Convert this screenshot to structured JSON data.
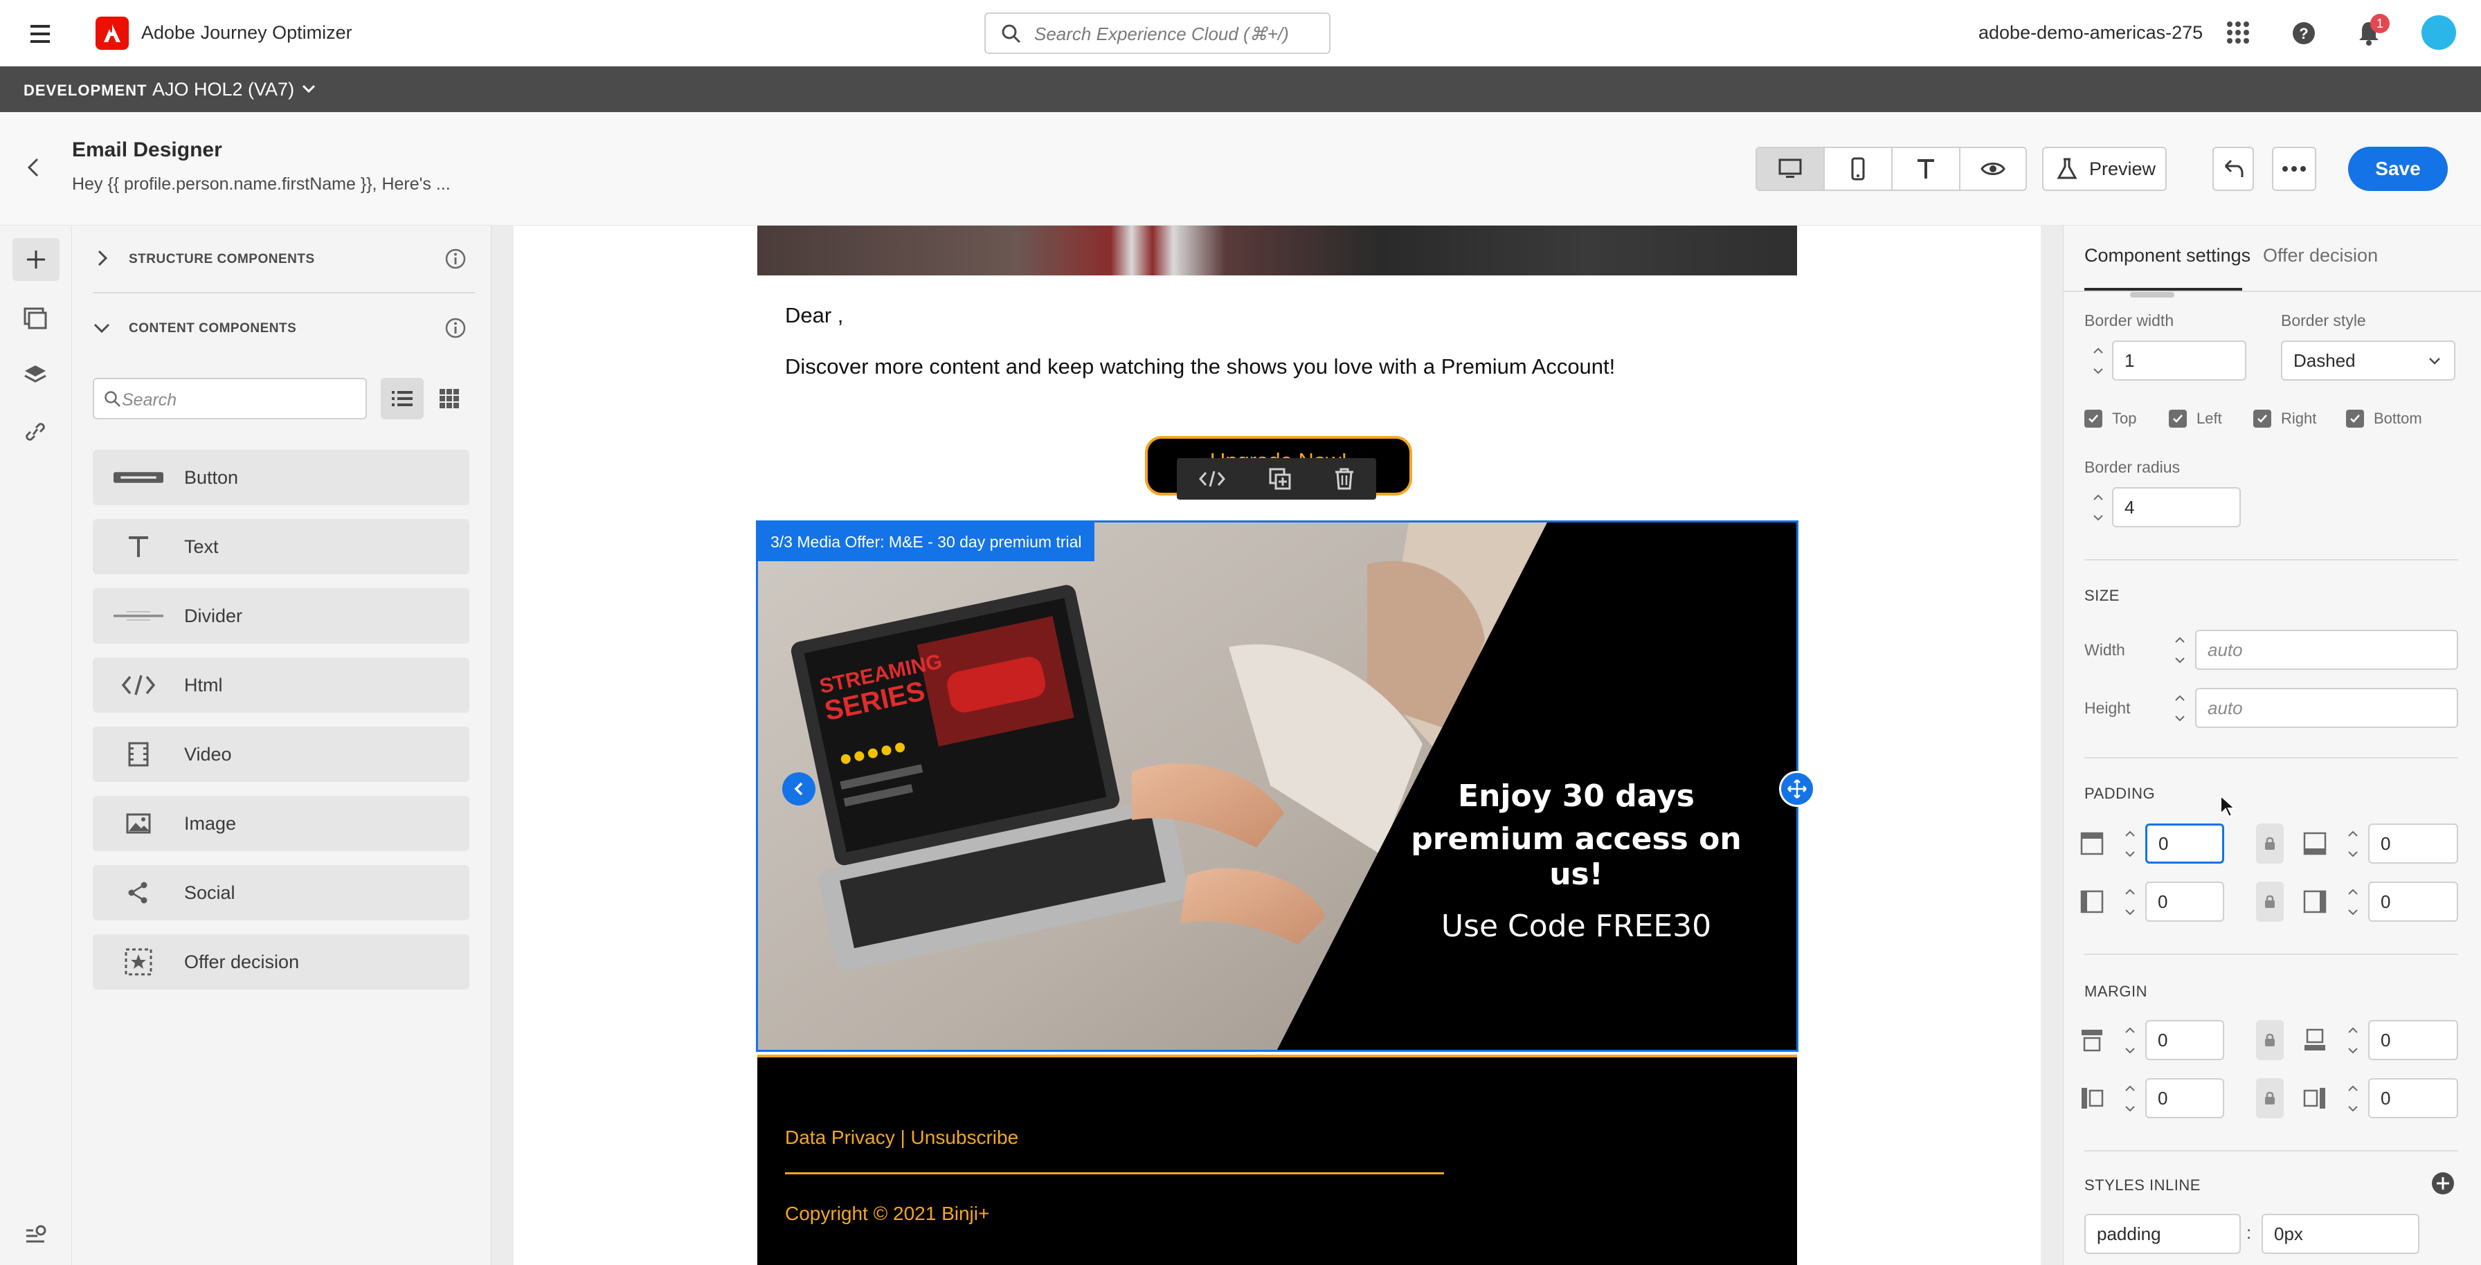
{
  "app": {
    "name": "Adobe Journey Optimizer",
    "search_placeholder": "Search Experience Cloud (⌘+/)",
    "org": "adobe-demo-americas-275",
    "notification_count": "1"
  },
  "env": {
    "label": "DEVELOPMENT",
    "sandbox": "AJO HOL2 (VA7)"
  },
  "designer": {
    "title": "Email Designer",
    "subtitle": "Hey {{ profile.person.name.firstName }}, Here's ...",
    "preview_label": "Preview",
    "save_label": "Save"
  },
  "left_panel": {
    "structure_title": "STRUCTURE COMPONENTS",
    "content_title": "CONTENT COMPONENTS",
    "search_placeholder": "Search",
    "items": [
      {
        "label": "Button",
        "icon": "button-icon"
      },
      {
        "label": "Text",
        "icon": "text-icon"
      },
      {
        "label": "Divider",
        "icon": "divider-icon"
      },
      {
        "label": "Html",
        "icon": "html-icon"
      },
      {
        "label": "Video",
        "icon": "video-icon"
      },
      {
        "label": "Image",
        "icon": "image-icon"
      },
      {
        "label": "Social",
        "icon": "share-icon"
      },
      {
        "label": "Offer decision",
        "icon": "offer-decision-icon"
      }
    ]
  },
  "email": {
    "greeting": "Dear ,",
    "body": "Discover more content and keep watching the shows you love with a Premium Account!",
    "button_label": "Upgrade Now!",
    "offer_tag": "3/3 Media Offer: M&E - 30 day premium trial",
    "offer_line1": "Enjoy 30 days",
    "offer_line2": "premium access on us!",
    "offer_code": "Use Code FREE30",
    "footer_links": "Data Privacy | Unsubscribe",
    "copyright": "Copyright © 2021 Binji+",
    "accent_color": "#f5a623"
  },
  "right_panel": {
    "tab_settings": "Component settings",
    "tab_offer": "Offer decision",
    "border_width_label": "Border width",
    "border_width": "1",
    "border_style_label": "Border style",
    "border_style": "Dashed",
    "sides": [
      "Top",
      "Left",
      "Right",
      "Bottom"
    ],
    "border_radius_label": "Border radius",
    "border_radius": "4",
    "size_title": "SIZE",
    "width_label": "Width",
    "height_label": "Height",
    "auto": "auto",
    "padding_title": "PADDING",
    "padding": {
      "top": "0",
      "bottom": "0",
      "left": "0",
      "right": "0"
    },
    "margin_title": "MARGIN",
    "margin": {
      "top": "0",
      "bottom": "0",
      "left": "0",
      "right": "0"
    },
    "styles_title": "STYLES INLINE",
    "style_prop": "padding",
    "style_sep": ":",
    "style_val": "0px"
  },
  "colors": {
    "brand_red": "#eb1000",
    "save_blue": "#1473e6",
    "selection_blue": "#1473e6"
  }
}
